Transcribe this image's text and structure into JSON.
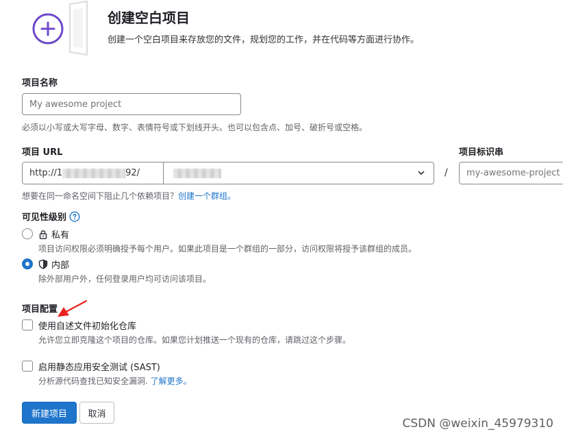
{
  "header": {
    "title": "创建空白项目",
    "description": "创建一个空白项目来存放您的文件，规划您的工作，并在代码等方面进行协作。"
  },
  "project_name": {
    "label": "项目名称",
    "placeholder": "My awesome project",
    "help": "必须以小写或大写字母、数字、表情符号或下划线开头。也可以包含点、加号、破折号或空格。"
  },
  "project_url": {
    "label": "项目 URL",
    "prefix_start": "http://1",
    "prefix_end": "92/",
    "help_text": "想要在同一命名空间下阻止几个依赖项目？",
    "help_link": "创建一个群组。"
  },
  "project_slug": {
    "label": "项目标识串",
    "placeholder": "my-awesome-project"
  },
  "separator": "/",
  "visibility": {
    "label": "可见性级别",
    "options": [
      {
        "label": "私有",
        "description": "项目访问权限必须明确授予每个用户。如果此项目是一个群组的一部分，访问权限将授予该群组的成员。",
        "checked": false,
        "icon": "lock-icon"
      },
      {
        "label": "内部",
        "description": "除外部用户外，任何登录用户均可访问该项目。",
        "checked": true,
        "icon": "shield-icon"
      }
    ]
  },
  "config": {
    "label": "项目配置",
    "readme": {
      "label": "使用自述文件初始化仓库",
      "description": "允许您立即克隆这个项目的仓库。如果您计划推送一个现有的仓库，请跳过这个步骤。",
      "checked": false
    },
    "sast": {
      "label": "启用静态应用安全测试 (SAST)",
      "description": "分析源代码查找已知安全漏洞.",
      "link": "了解更多。",
      "checked": false
    }
  },
  "actions": {
    "create": "新建项目",
    "cancel": "取消"
  },
  "watermark": "CSDN @weixin_45979310",
  "colors": {
    "primary": "#1f75cb",
    "accent_purple": "#6e49cb",
    "annotation_arrow": "#e8231f"
  }
}
